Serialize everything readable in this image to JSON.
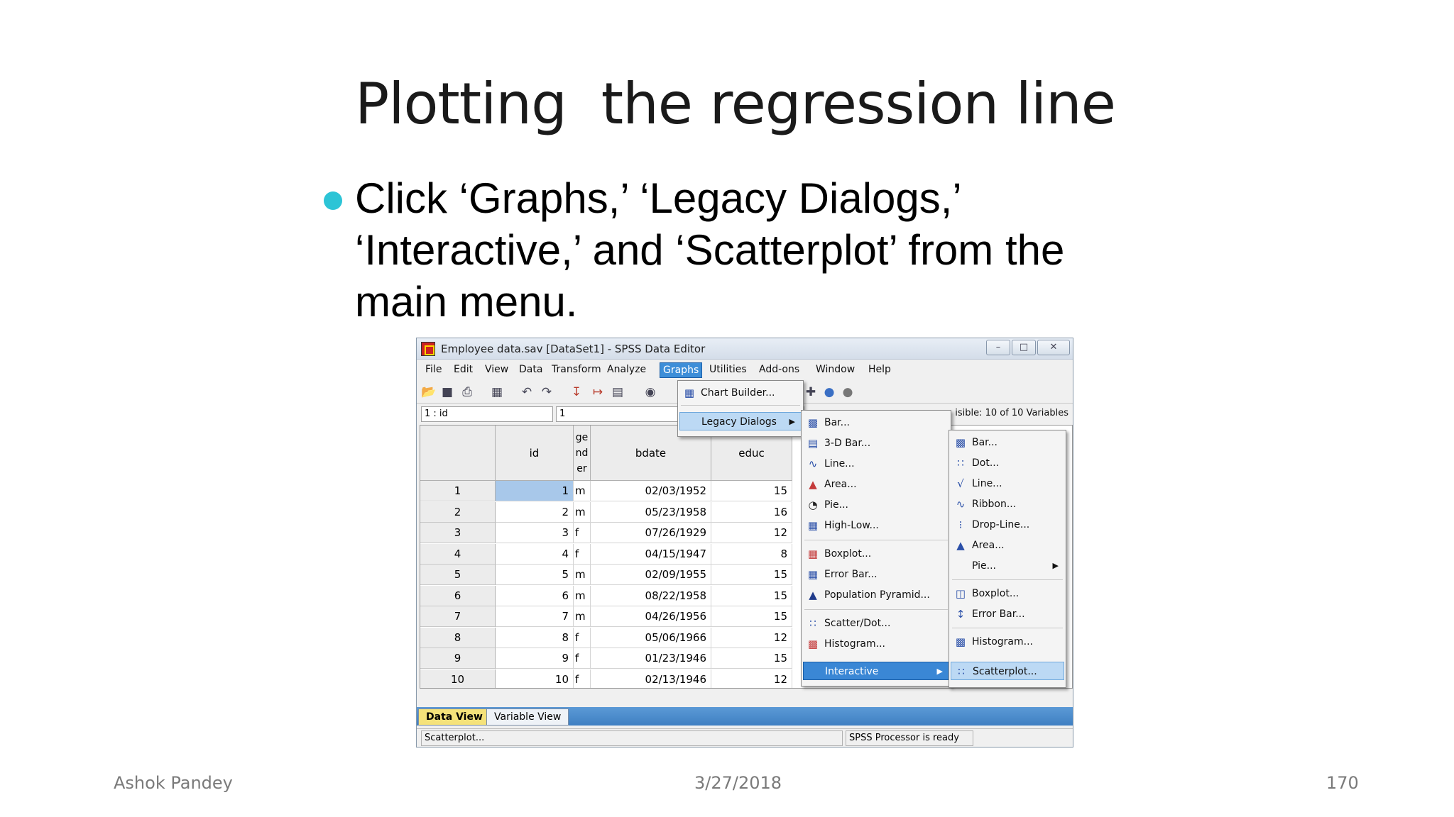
{
  "slide": {
    "title": "Plotting  the regression line",
    "bullet": "Click ‘Graphs,’ ‘Legacy Dialogs,’ ‘Interactive,’  and ‘Scatterplot’ from the main menu.",
    "footer_author": "Ashok Pandey",
    "footer_date": "3/27/2018",
    "footer_page": "170"
  },
  "window": {
    "title": "Employee data.sav [DataSet1] - SPSS Data Editor",
    "menus": [
      "File",
      "Edit",
      "View",
      "Data",
      "Transform",
      "Analyze",
      "Graphs",
      "Utilities",
      "Add-ons",
      "Window",
      "Help"
    ],
    "active_menu": "Graphs",
    "cell_ref": "1 : id",
    "cell_value": "1",
    "visible_vars": "isible: 10 of 10 Variables",
    "columns": [
      "id",
      "ge\nnd\ner",
      "bdate",
      "educ"
    ],
    "rows": [
      {
        "n": "1",
        "id": "1",
        "gender": "m",
        "bdate": "02/03/1952",
        "educ": "15"
      },
      {
        "n": "2",
        "id": "2",
        "gender": "m",
        "bdate": "05/23/1958",
        "educ": "16"
      },
      {
        "n": "3",
        "id": "3",
        "gender": "f",
        "bdate": "07/26/1929",
        "educ": "12"
      },
      {
        "n": "4",
        "id": "4",
        "gender": "f",
        "bdate": "04/15/1947",
        "educ": "8"
      },
      {
        "n": "5",
        "id": "5",
        "gender": "m",
        "bdate": "02/09/1955",
        "educ": "15"
      },
      {
        "n": "6",
        "id": "6",
        "gender": "m",
        "bdate": "08/22/1958",
        "educ": "15"
      },
      {
        "n": "7",
        "id": "7",
        "gender": "m",
        "bdate": "04/26/1956",
        "educ": "15"
      },
      {
        "n": "8",
        "id": "8",
        "gender": "f",
        "bdate": "05/06/1966",
        "educ": "12"
      },
      {
        "n": "9",
        "id": "9",
        "gender": "f",
        "bdate": "01/23/1946",
        "educ": "15"
      },
      {
        "n": "10",
        "id": "10",
        "gender": "f",
        "bdate": "02/13/1946",
        "educ": "12"
      }
    ],
    "tabs": [
      "Data View",
      "Variable View"
    ],
    "status_left": "Scatterplot...",
    "status_right": "SPSS  Processor is ready"
  },
  "graphs_menu": {
    "items": [
      "Chart Builder...",
      "Legacy Dialogs"
    ]
  },
  "legacy_menu": {
    "items": [
      "Bar...",
      "3-D Bar...",
      "Line...",
      "Area...",
      "Pie...",
      "High-Low...",
      "Boxplot...",
      "Error Bar...",
      "Population Pyramid...",
      "Scatter/Dot...",
      "Histogram...",
      "Interactive"
    ]
  },
  "interactive_menu": {
    "items": [
      "Bar...",
      "Dot...",
      "Line...",
      "Ribbon...",
      "Drop-Line...",
      "Area...",
      "Pie...",
      "Boxplot...",
      "Error Bar...",
      "Histogram...",
      "Scatterplot..."
    ]
  }
}
